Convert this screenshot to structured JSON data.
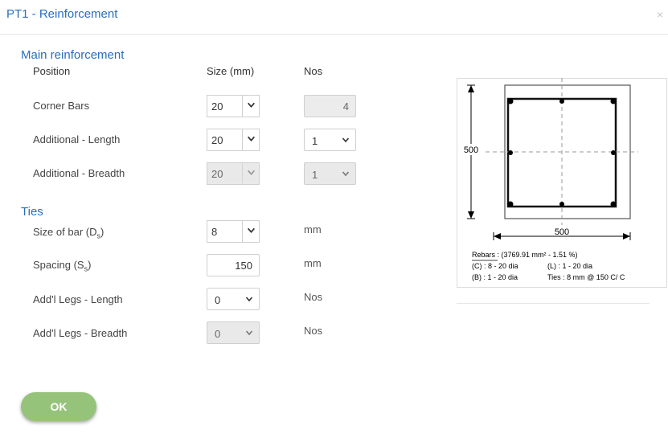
{
  "dialog": {
    "title": "PT1 - Reinforcement",
    "close_glyph": "×"
  },
  "main_reinforcement": {
    "heading": "Main reinforcement",
    "col_position": "Position",
    "col_size": "Size (mm)",
    "col_nos": "Nos",
    "rows": [
      {
        "label": "Corner Bars",
        "size": "20",
        "nos": "4"
      },
      {
        "label": "Additional - Length",
        "size": "20",
        "nos": "1"
      },
      {
        "label": "Additional - Breadth",
        "size": "20",
        "nos": "1"
      }
    ]
  },
  "ties": {
    "heading": "Ties",
    "size_label": "Size of bar (D",
    "size_sub": "s",
    "size_label_end": ")",
    "size_value": "8",
    "size_unit": "mm",
    "spacing_label": "Spacing (S",
    "spacing_sub": "s",
    "spacing_label_end": ")",
    "spacing_value": "150",
    "spacing_unit": "mm",
    "legs_length_label": "Add'l Legs - Length",
    "legs_length_value": "0",
    "legs_length_unit": "Nos",
    "legs_breadth_label": "Add'l Legs - Breadth",
    "legs_breadth_value": "0",
    "legs_breadth_unit": "Nos"
  },
  "diagram": {
    "height_dim": "500",
    "width_dim": "500",
    "rebars_text": "Rebars : (3769.91 mm² - 1.51 %)",
    "c_text": "(C) : 8 - 20 dia",
    "l_text": "(L) : 1 - 20 dia",
    "b_text": "(B) : 1 - 20 dia",
    "ties_text": "Ties : 8 mm @ 150 C/ C"
  },
  "buttons": {
    "ok": "OK"
  },
  "colors": {
    "accent": "#2a6ebb",
    "ok_button": "#96c37a"
  }
}
